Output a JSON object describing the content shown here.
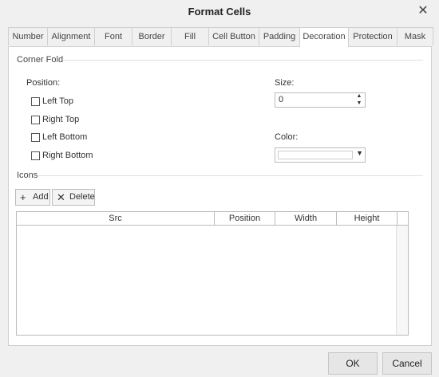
{
  "window": {
    "title": "Format Cells",
    "close_symbol": "✕"
  },
  "tabs": [
    {
      "label": "Number"
    },
    {
      "label": "Alignment"
    },
    {
      "label": "Font"
    },
    {
      "label": "Border"
    },
    {
      "label": "Fill"
    },
    {
      "label": "Cell Button"
    },
    {
      "label": "Padding"
    },
    {
      "label": "Decoration"
    },
    {
      "label": "Protection"
    },
    {
      "label": "Mask"
    }
  ],
  "corner_fold": {
    "section_label": "Corner Fold",
    "position_label": "Position:",
    "options": [
      {
        "label": "Left Top",
        "checked": false
      },
      {
        "label": "Right Top",
        "checked": false
      },
      {
        "label": "Left Bottom",
        "checked": false
      },
      {
        "label": "Right Bottom",
        "checked": false
      }
    ],
    "size_label": "Size:",
    "size_value": "0",
    "color_label": "Color:",
    "color_value": "#ffffff"
  },
  "icons": {
    "section_label": "Icons",
    "add_label": "Add",
    "delete_label": "Delete",
    "columns": [
      "Src",
      "Position",
      "Width",
      "Height"
    ],
    "rows": []
  },
  "footer": {
    "ok_label": "OK",
    "cancel_label": "Cancel"
  }
}
